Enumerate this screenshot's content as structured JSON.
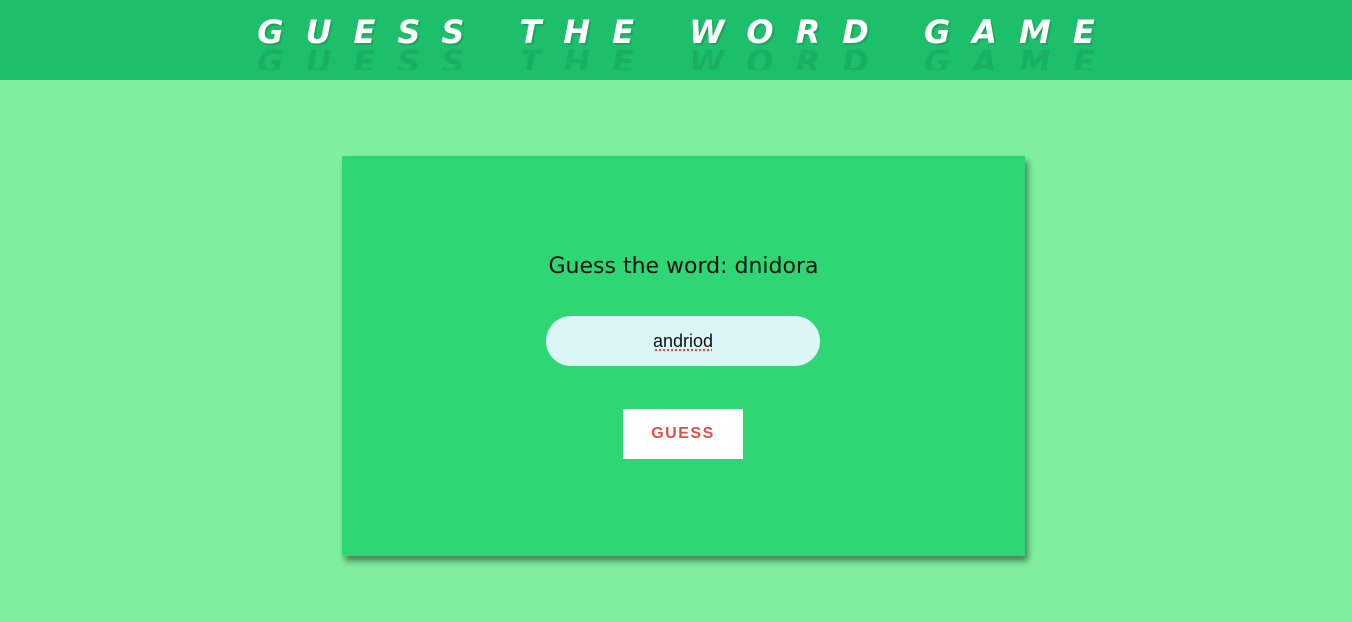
{
  "header": {
    "title": "GUESS THE WORD GAME"
  },
  "game": {
    "prompt": "Guess the word: dnidora",
    "input_value": "andriod",
    "guess_button_label": "GUESS"
  },
  "colors": {
    "page_background": "#7fef9f",
    "header_background": "#1ebf6b",
    "card_background": "#2ed774",
    "input_background": "#dcf6f8",
    "button_text": "#e0504a"
  }
}
